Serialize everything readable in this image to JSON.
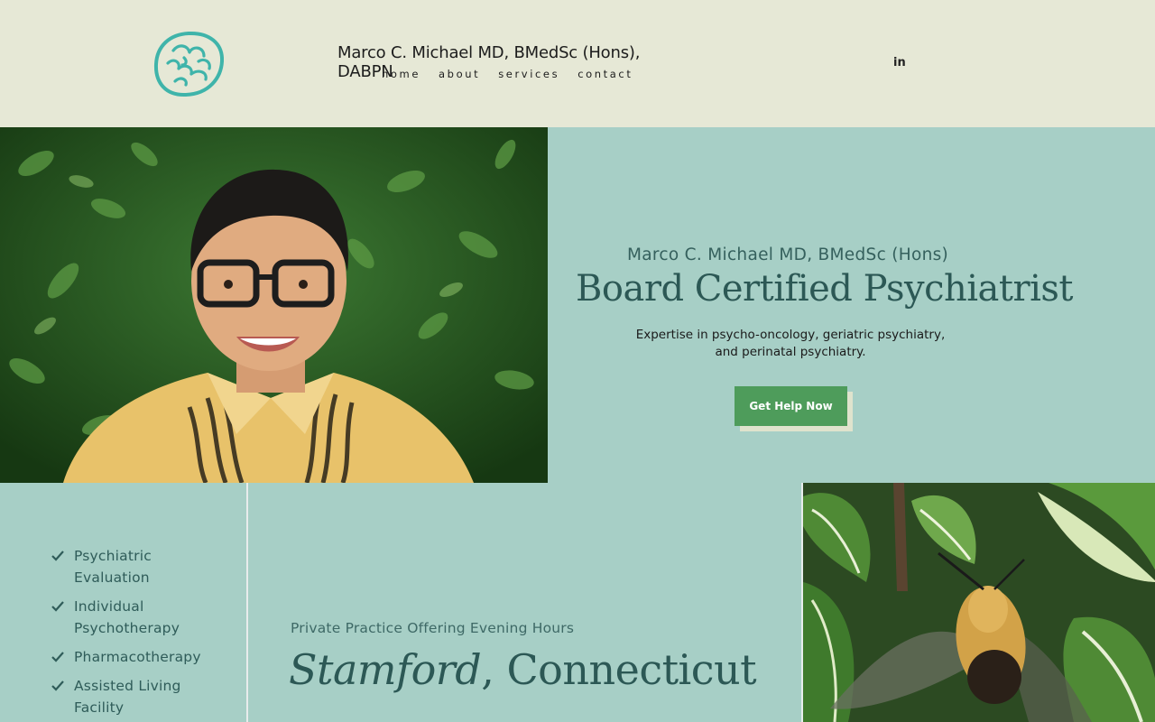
{
  "header": {
    "site_title": "Marco C. Michael MD, BMedSc (Hons), DABPN",
    "nav": [
      {
        "label": "home"
      },
      {
        "label": "about"
      },
      {
        "label": "services"
      },
      {
        "label": "contact"
      }
    ],
    "social": {
      "label": "in",
      "icon": "linkedin-icon"
    },
    "logo_icon": "brain-icon"
  },
  "hero": {
    "subtitle": "Marco C. Michael MD, BMedSc (Hons)",
    "title": "Board Certified Psychiatrist",
    "description_line1": "Expertise in psycho-oncology, geriatric psychiatry,",
    "description_line2": "and perinatal psychiatry.",
    "cta_label": "Get Help Now"
  },
  "services": [
    {
      "label": "Psychiatric Evaluation"
    },
    {
      "label": "Individual Psychotherapy"
    },
    {
      "label": "Pharmacotherapy"
    },
    {
      "label": "Assisted Living Facility"
    }
  ],
  "location": {
    "subtitle": "Private Practice Offering Evening Hours",
    "city": "Stamford",
    "state": ", Connecticut"
  },
  "colors": {
    "header_bg": "#e6e8d6",
    "page_bg": "#a7cfc6",
    "accent_teal": "#2c5855",
    "cta_green": "#4e9c5b",
    "logo_teal": "#3fb4aa"
  }
}
